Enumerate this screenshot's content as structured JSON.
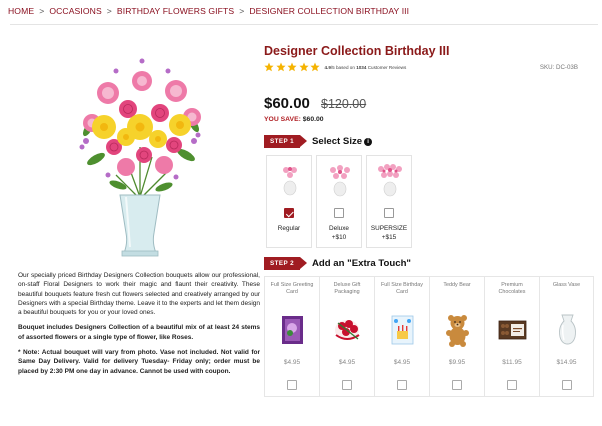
{
  "breadcrumb": [
    "HOME",
    "OCCASIONS",
    "BIRTHDAY FLOWERS GIFTS",
    "DESIGNER COLLECTION BIRTHDAY III"
  ],
  "product": {
    "title": "Designer Collection Birthday III",
    "rating_value": "4.9",
    "rating_suffix": "/5 based on",
    "review_count": "1034",
    "review_label": "Customer Reviews",
    "stars": 4.9,
    "sku": "SKU: DC-03B",
    "price": "$60.00",
    "old_price": "$120.00",
    "save_label": "YOU SAVE:",
    "save_amount": "$60.00"
  },
  "description": {
    "para1": "Our specially priced Birthday Designers Collection bouquets allow our professional, on-staff Floral Designers to work their magic and flaunt their creativity. These beautiful bouquets feature fresh cut flowers selected and creatively arranged by our Designers with a special Birthday theme. Leave it to the experts and let them design a beautiful bouquets for you or your loved ones.",
    "para2": "Bouquet includes Designers Collection of a beautiful mix of at least 24 stems of assorted flowers or a single type of flower, like Roses.",
    "para3": "* Note: Actual bouquet will vary from photo. Vase not included. Not valid for Same Day Delivery. Valid for delivery Tuesday- Friday only; order must be placed by 2:30 PM one day in advance. Cannot be used with coupon."
  },
  "step1": {
    "badge": "STEP 1",
    "title": "Select Size",
    "sizes": [
      {
        "label": "Regular",
        "extra": "",
        "checked": true
      },
      {
        "label": "Deluxe",
        "extra": "+$10",
        "checked": false
      },
      {
        "label": "SUPERSIZE",
        "extra": "+$15",
        "checked": false
      }
    ]
  },
  "step2": {
    "badge": "STEP 2",
    "title": "Add an \"Extra Touch\"",
    "extras": [
      {
        "name": "Full Size Greeting Card",
        "price": "$4.95",
        "icon": "greeting-card-icon"
      },
      {
        "name": "Deluxe Gift Packaging",
        "price": "$4.95",
        "icon": "gift-packaging-icon"
      },
      {
        "name": "Full Size Birthday Card",
        "price": "$4.95",
        "icon": "birthday-card-icon"
      },
      {
        "name": "Teddy Bear",
        "price": "$9.95",
        "icon": "teddy-bear-icon"
      },
      {
        "name": "Premium Chocolates",
        "price": "$11.95",
        "icon": "chocolates-icon"
      },
      {
        "name": "Glass Vase",
        "price": "$14.95",
        "icon": "glass-vase-icon"
      }
    ]
  },
  "colors": {
    "accent": "#a01c22",
    "title": "#8b1a1a",
    "star": "#f5b301"
  }
}
